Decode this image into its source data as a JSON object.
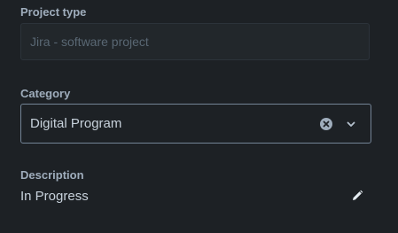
{
  "project_type": {
    "label": "Project type",
    "value": "Jira - software project"
  },
  "category": {
    "label": "Category",
    "selected": "Digital Program",
    "icons": {
      "clear": "clear-circle-icon",
      "dropdown": "chevron-down-icon"
    }
  },
  "description": {
    "label": "Description",
    "value": "In Progress",
    "icons": {
      "edit": "pencil-icon"
    }
  },
  "colors": {
    "background": "#1d2125",
    "label": "#9fadbc",
    "text": "#c7d1db",
    "disabled_text": "#596773",
    "border": "#738496"
  }
}
